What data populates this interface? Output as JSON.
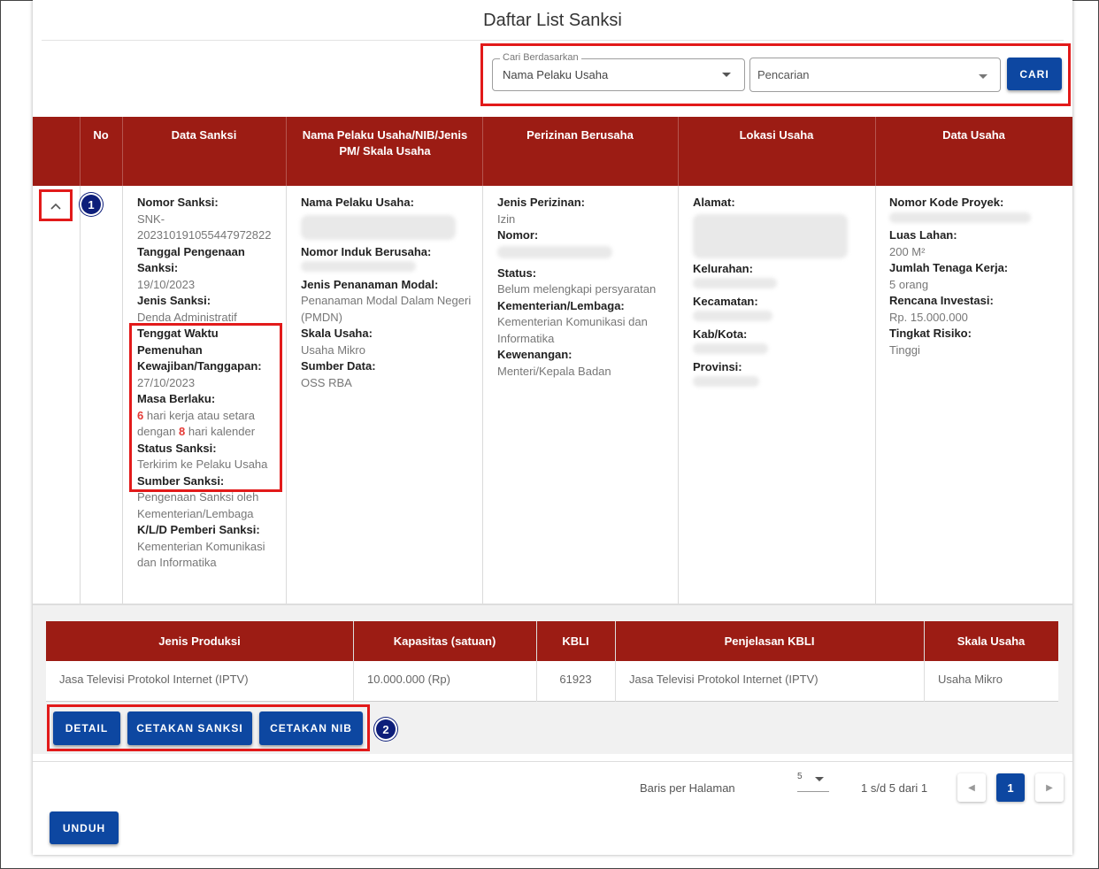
{
  "page": {
    "title": "Daftar List Sanksi"
  },
  "search": {
    "legend": "Cari Berdasarkan",
    "field_value": "Nama Pelaku Usaha",
    "query_value": "Pencarian",
    "button_label": "CARI"
  },
  "table": {
    "headers": {
      "no": "No",
      "data_sanksi": "Data Sanksi",
      "nama_pelaku": "Nama Pelaku Usaha/NIB/Jenis PM/ Skala Usaha",
      "perizinan": "Perizinan Berusaha",
      "lokasi": "Lokasi Usaha",
      "data_usaha": "Data Usaha"
    },
    "row_number_badge": "1",
    "data_sanksi": {
      "nomor_label": "Nomor Sanksi:",
      "nomor_value": "SNK-20231019105544797 2822",
      "nomor_line1": "SNK-",
      "nomor_line2": "20231019105544797 2822",
      "tanggal_label": "Tanggal Pengenaan Sanksi:",
      "tanggal_value": "19/10/2023",
      "jenis_label": "Jenis Sanksi:",
      "jenis_value": "Denda Administratif",
      "tenggat_label": "Tenggat Waktu Pemenuhan Kewajiban/Tanggapan:",
      "tenggat_value": "27/10/2023",
      "masa_label": "Masa Berlaku:",
      "masa_num1": "6",
      "masa_text1": "hari kerja atau setara dengan",
      "masa_num2": "8",
      "masa_text2": "hari kalender",
      "status_label": "Status Sanksi:",
      "status_value": "Terkirim ke Pelaku Usaha",
      "sumber_label": "Sumber Sanksi:",
      "sumber_value": "Pengenaan Sanksi oleh Kementerian/Lembaga",
      "kld_label": "K/L/D Pemberi Sanksi:",
      "kld_value": "Kementerian Komunikasi dan Informatika"
    },
    "pelaku": {
      "nama_label": "Nama Pelaku Usaha:",
      "nib_label": "Nomor Induk Berusaha:",
      "pm_label": "Jenis Penanaman Modal:",
      "pm_value": "Penanaman Modal Dalam Negeri (PMDN)",
      "skala_label": "Skala Usaha:",
      "skala_value": "Usaha Mikro",
      "sumber_label": "Sumber Data:",
      "sumber_value": "OSS RBA"
    },
    "perizinan": {
      "jenis_label": "Jenis Perizinan:",
      "jenis_value": "Izin",
      "nomor_label": "Nomor:",
      "status_label": "Status:",
      "status_value": "Belum melengkapi persyaratan",
      "kl_label": "Kementerian/Lembaga:",
      "kl_value": "Kementerian Komunikasi dan Informatika",
      "kewenangan_label": "Kewenangan:",
      "kewenangan_value": "Menteri/Kepala Badan"
    },
    "lokasi": {
      "alamat_label": "Alamat:",
      "kelurahan_label": "Kelurahan:",
      "kecamatan_label": "Kecamatan:",
      "kabkota_label": "Kab/Kota:",
      "provinsi_label": "Provinsi:"
    },
    "data_usaha": {
      "kode_label": "Nomor Kode Proyek:",
      "luas_label": "Luas Lahan:",
      "luas_value": "200 M²",
      "tenaga_label": "Jumlah Tenaga Kerja:",
      "tenaga_value": "5 orang",
      "investasi_label": "Rencana Investasi:",
      "investasi_value": "Rp. 15.000.000",
      "risiko_label": "Tingkat Risiko:",
      "risiko_value": "Tinggi"
    }
  },
  "produk_table": {
    "headers": [
      "Jenis Produksi",
      "Kapasitas (satuan)",
      "KBLI",
      "Penjelasan KBLI",
      "Skala Usaha"
    ],
    "row": [
      "Jasa Televisi Protokol Internet (IPTV)",
      "10.000.000 (Rp)",
      "61923",
      "Jasa Televisi Protokol Internet (IPTV)",
      "Usaha Mikro"
    ]
  },
  "actions": {
    "detail": "DETAIL",
    "cetakan_sanksi": "CETAKAN SANKSI",
    "cetakan_nib": "CETAKAN NIB",
    "badge": "2"
  },
  "pagination": {
    "rows_label": "Baris per Halaman",
    "rows_value": "5",
    "range_text": "1 s/d 5 dari 1",
    "current_page": "1"
  },
  "download": {
    "label": "UNDUH"
  },
  "colors": {
    "header_red": "#9c1c14",
    "primary_blue": "#0d47a1",
    "highlight_red": "#e21a1a"
  }
}
